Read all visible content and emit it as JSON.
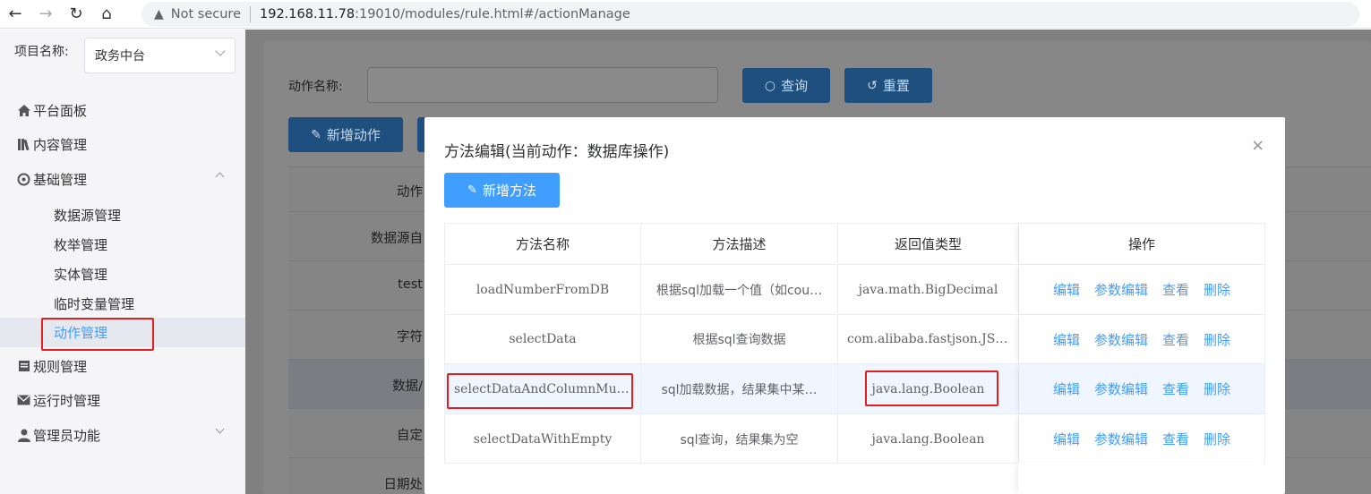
{
  "browser": {
    "back": "←",
    "forward": "→",
    "reload": "↻",
    "home": "⌂",
    "security": "Not secure",
    "url_host": "192.168.11.78",
    "url_rest": ":19010/modules/rule.html#/actionManage"
  },
  "sidebar": {
    "project_label": "项目名称:",
    "project_value": "政务中台",
    "menu": {
      "dashboard": "平台面板",
      "content": "内容管理",
      "basic": "基础管理",
      "rules": "规则管理",
      "runtime": "运行时管理",
      "admin": "管理员功能"
    },
    "sub": {
      "datasource": "数据源管理",
      "enum": "枚举管理",
      "entity": "实体管理",
      "tempvar": "临时变量管理",
      "action": "动作管理"
    }
  },
  "main": {
    "filter_label": "动作名称:",
    "search_btn": "查询",
    "reset_btn": "重置",
    "add_action_btn": "新增动作",
    "table_header": "动作",
    "rows": [
      "数据源自",
      "test",
      "字符",
      "数据/",
      "自定",
      "日期处"
    ]
  },
  "modal": {
    "title": "方法编辑(当前动作：数据库操作)",
    "close": "×",
    "add_method_btn": "新增方法",
    "headers": {
      "name": "方法名称",
      "desc": "方法描述",
      "return": "返回值类型",
      "ops": "操作"
    },
    "rows": [
      {
        "name": "loadNumberFromDB",
        "desc": "根据sql加载一个值（如cou…",
        "ret": "java.math.BigDecimal"
      },
      {
        "name": "selectData",
        "desc": "根据sql查询数据",
        "ret": "com.alibaba.fastjson.JSONA…"
      },
      {
        "name": "selectDataAndColumnMustI…",
        "desc": "sql加载数据，结果集中某…",
        "ret": "java.lang.Boolean"
      },
      {
        "name": "selectDataWithEmpty",
        "desc": "sql查询，结果集为空",
        "ret": "java.lang.Boolean"
      }
    ],
    "actions": {
      "edit": "编辑",
      "param_edit": "参数编辑",
      "view": "查看",
      "delete": "删除"
    }
  },
  "colors": {
    "primary": "#409eff",
    "highlight": "#e02020",
    "overlay": "#808080"
  }
}
